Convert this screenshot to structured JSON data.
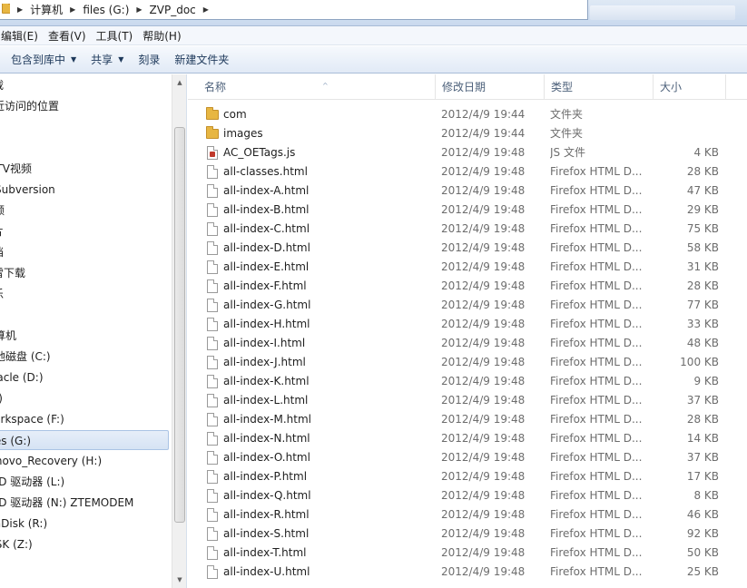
{
  "address": {
    "crumbs": [
      "计算机",
      "files (G:)",
      "ZVP_doc"
    ]
  },
  "menu": [
    "编辑(E)",
    "查看(V)",
    "工具(T)",
    "帮助(H)"
  ],
  "toolbar": {
    "library_label": "包含到库中",
    "share_label": "共享",
    "burn_label": "刻录",
    "new_folder_label": "新建文件夹"
  },
  "nav": {
    "items": [
      "下载",
      "最近访问的位置",
      "",
      "库",
      "PPTV视频",
      "Subversion",
      "视频",
      "图片",
      "文档",
      "迅雷下载",
      "音乐",
      "",
      "计算机",
      "本地磁盘 (C:)",
      "Oracle (D:)",
      "(E:)",
      "Workspace (F:)",
      "files (G:)",
      "Lenovo_Recovery (H:)",
      "DVD 驱动器 (L:)",
      "DVD 驱动器 (N:) ZTEMODEM",
      "YunDisk (R:)",
      "DISK (Z:)"
    ]
  },
  "columns": {
    "name": "名称",
    "date": "修改日期",
    "type": "类型",
    "size": "大小"
  },
  "files": [
    {
      "name": "com",
      "date": "2012/4/9 19:44",
      "type": "文件夹",
      "size": "",
      "kind": "folder"
    },
    {
      "name": "images",
      "date": "2012/4/9 19:44",
      "type": "文件夹",
      "size": "",
      "kind": "folder"
    },
    {
      "name": "AC_OETags.js",
      "date": "2012/4/9 19:48",
      "type": "JS 文件",
      "size": "4 KB",
      "kind": "js"
    },
    {
      "name": "all-classes.html",
      "date": "2012/4/9 19:48",
      "type": "Firefox HTML D...",
      "size": "28 KB",
      "kind": "html"
    },
    {
      "name": "all-index-A.html",
      "date": "2012/4/9 19:48",
      "type": "Firefox HTML D...",
      "size": "47 KB",
      "kind": "html"
    },
    {
      "name": "all-index-B.html",
      "date": "2012/4/9 19:48",
      "type": "Firefox HTML D...",
      "size": "29 KB",
      "kind": "html"
    },
    {
      "name": "all-index-C.html",
      "date": "2012/4/9 19:48",
      "type": "Firefox HTML D...",
      "size": "75 KB",
      "kind": "html"
    },
    {
      "name": "all-index-D.html",
      "date": "2012/4/9 19:48",
      "type": "Firefox HTML D...",
      "size": "58 KB",
      "kind": "html"
    },
    {
      "name": "all-index-E.html",
      "date": "2012/4/9 19:48",
      "type": "Firefox HTML D...",
      "size": "31 KB",
      "kind": "html"
    },
    {
      "name": "all-index-F.html",
      "date": "2012/4/9 19:48",
      "type": "Firefox HTML D...",
      "size": "28 KB",
      "kind": "html"
    },
    {
      "name": "all-index-G.html",
      "date": "2012/4/9 19:48",
      "type": "Firefox HTML D...",
      "size": "77 KB",
      "kind": "html"
    },
    {
      "name": "all-index-H.html",
      "date": "2012/4/9 19:48",
      "type": "Firefox HTML D...",
      "size": "33 KB",
      "kind": "html"
    },
    {
      "name": "all-index-I.html",
      "date": "2012/4/9 19:48",
      "type": "Firefox HTML D...",
      "size": "48 KB",
      "kind": "html"
    },
    {
      "name": "all-index-J.html",
      "date": "2012/4/9 19:48",
      "type": "Firefox HTML D...",
      "size": "100 KB",
      "kind": "html"
    },
    {
      "name": "all-index-K.html",
      "date": "2012/4/9 19:48",
      "type": "Firefox HTML D...",
      "size": "9 KB",
      "kind": "html"
    },
    {
      "name": "all-index-L.html",
      "date": "2012/4/9 19:48",
      "type": "Firefox HTML D...",
      "size": "37 KB",
      "kind": "html"
    },
    {
      "name": "all-index-M.html",
      "date": "2012/4/9 19:48",
      "type": "Firefox HTML D...",
      "size": "28 KB",
      "kind": "html"
    },
    {
      "name": "all-index-N.html",
      "date": "2012/4/9 19:48",
      "type": "Firefox HTML D...",
      "size": "14 KB",
      "kind": "html"
    },
    {
      "name": "all-index-O.html",
      "date": "2012/4/9 19:48",
      "type": "Firefox HTML D...",
      "size": "37 KB",
      "kind": "html"
    },
    {
      "name": "all-index-P.html",
      "date": "2012/4/9 19:48",
      "type": "Firefox HTML D...",
      "size": "17 KB",
      "kind": "html"
    },
    {
      "name": "all-index-Q.html",
      "date": "2012/4/9 19:48",
      "type": "Firefox HTML D...",
      "size": "8 KB",
      "kind": "html"
    },
    {
      "name": "all-index-R.html",
      "date": "2012/4/9 19:48",
      "type": "Firefox HTML D...",
      "size": "46 KB",
      "kind": "html"
    },
    {
      "name": "all-index-S.html",
      "date": "2012/4/9 19:48",
      "type": "Firefox HTML D...",
      "size": "92 KB",
      "kind": "html"
    },
    {
      "name": "all-index-T.html",
      "date": "2012/4/9 19:48",
      "type": "Firefox HTML D...",
      "size": "50 KB",
      "kind": "html"
    },
    {
      "name": "all-index-U.html",
      "date": "2012/4/9 19:48",
      "type": "Firefox HTML D...",
      "size": "25 KB",
      "kind": "html"
    }
  ]
}
